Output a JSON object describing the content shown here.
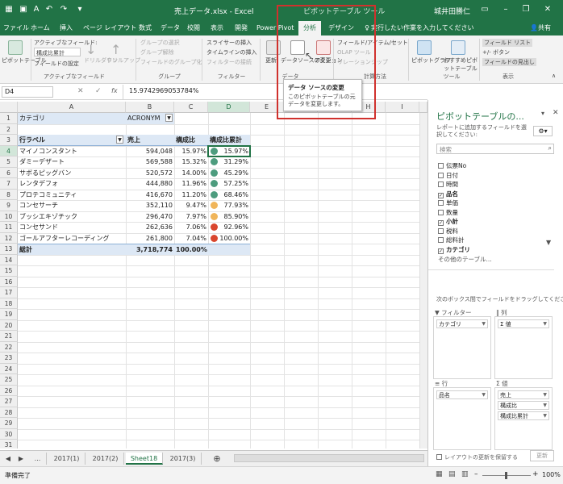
{
  "titlebar": {
    "title": "売上データ.xlsx - Excel",
    "context_tool": "ピボットテーブル ツール",
    "user": "城井田勝仁"
  },
  "tabs": [
    "ファイル",
    "ホーム",
    "挿入",
    "ページ レイアウト",
    "数式",
    "データ",
    "校閲",
    "表示",
    "開発",
    "Power Pivot",
    "分析",
    "デザイン"
  ],
  "tell_me": "実行したい作業を入力してください",
  "share": "共有",
  "ribbon": {
    "pivot_table": "ピボットテーブル",
    "active_field": "アクティブなフィールド:",
    "active_field_value": "構成比累計",
    "field_settings": "フィールドの設定",
    "drill_down": "ドリルダウン",
    "drill_up": "ドリルアップ",
    "group_selection": "グループの選択",
    "ungroup": "グループ解除",
    "group_field": "フィールドのグループ化",
    "insert_slicer": "スライサーの挿入",
    "insert_timeline": "タイムラインの挿入",
    "filter_connections": "フィルターの接続",
    "refresh": "更新",
    "change_source": "データソースの変更",
    "actions": "アクション",
    "fields_items_sets": "フィールド/アイテム/セット",
    "olap_tools": "OLAP ツール",
    "relationships": "リレーションシップ",
    "pivot_chart": "ピボットグラフ",
    "recommended": "おすすめピボットテーブル",
    "field_list": "フィールド リスト",
    "plus_minus": "+/- ボタン",
    "field_headers": "フィールドの見出し",
    "group_labels": [
      "アクティブなフィールド",
      "グループ",
      "フィルター",
      "データ",
      "計算方法",
      "ツール",
      "表示"
    ]
  },
  "tooltip": {
    "title": "データ ソースの変更",
    "body": "このピボットテーブルの元データを変更します。"
  },
  "formula_bar": {
    "name_box": "D4",
    "fx": "fx",
    "formula": "15.9742969053784%"
  },
  "columns": [
    "A",
    "B",
    "C",
    "D",
    "E",
    "F",
    "G",
    "H",
    "I"
  ],
  "rows_numbers": [
    "1",
    "2",
    "3",
    "4",
    "5",
    "6",
    "7",
    "8",
    "9",
    "10",
    "11",
    "12",
    "13",
    "14",
    "15",
    "16",
    "17",
    "18",
    "19",
    "20",
    "21",
    "22",
    "23",
    "24",
    "25",
    "26",
    "27",
    "28",
    "29",
    "30",
    "31",
    "32"
  ],
  "sheet": {
    "filter_label": "カテゴリ",
    "filter_value": "ACRONYM",
    "headers": [
      "行ラベル",
      "売上",
      "構成比",
      "構成比累計"
    ],
    "rows": [
      {
        "label": "マイノコンスタント",
        "sales": "594,048",
        "ratio": "15.97%",
        "cum": "15.97%",
        "dot": "#4d9c7e"
      },
      {
        "label": "ダミーデザート",
        "sales": "569,588",
        "ratio": "15.32%",
        "cum": "31.29%",
        "dot": "#4d9c7e"
      },
      {
        "label": "サボるピッグバン",
        "sales": "520,572",
        "ratio": "14.00%",
        "cum": "45.29%",
        "dot": "#4d9c7e"
      },
      {
        "label": "レンタデフォ",
        "sales": "444,880",
        "ratio": "11.96%",
        "cum": "57.25%",
        "dot": "#4d9c7e"
      },
      {
        "label": "プロテコミュニティ",
        "sales": "416,670",
        "ratio": "11.20%",
        "cum": "68.46%",
        "dot": "#4d9c7e"
      },
      {
        "label": "コンセサーチ",
        "sales": "352,110",
        "ratio": "9.47%",
        "cum": "77.93%",
        "dot": "#f0b55a"
      },
      {
        "label": "ブッシエキゾチック",
        "sales": "296,470",
        "ratio": "7.97%",
        "cum": "85.90%",
        "dot": "#f0b55a"
      },
      {
        "label": "コンセサンド",
        "sales": "262,636",
        "ratio": "7.06%",
        "cum": "92.96%",
        "dot": "#d9462e"
      },
      {
        "label": "ゴールアフターレコーディング",
        "sales": "261,800",
        "ratio": "7.04%",
        "cum": "100.00%",
        "dot": "#d9462e"
      }
    ],
    "total": {
      "label": "総計",
      "sales": "3,718,774",
      "ratio": "100.00%"
    }
  },
  "sheet_tabs": [
    "...",
    "2017(1)",
    "2017(2)",
    "Sheet18",
    "2017(3)"
  ],
  "status": "準備完了",
  "zoom": "100%",
  "pane": {
    "title": "ピボットテーブルの...",
    "subtitle": "レポートに追加するフィールドを選択してください:",
    "search": "検索",
    "fields": [
      {
        "name": "伝票No",
        "checked": false
      },
      {
        "name": "日付",
        "checked": false
      },
      {
        "name": "時間",
        "checked": false
      },
      {
        "name": "品名",
        "checked": true
      },
      {
        "name": "単価",
        "checked": false
      },
      {
        "name": "数量",
        "checked": false
      },
      {
        "name": "小計",
        "checked": true
      },
      {
        "name": "税料",
        "checked": false
      },
      {
        "name": "総料計",
        "checked": false
      },
      {
        "name": "カテゴリ",
        "checked": true
      }
    ],
    "other_tables": "その他のテーブル...",
    "drag_hint": "次のボックス間でフィールドをドラッグしてください:",
    "area_filter": "フィルター",
    "area_columns": "列",
    "area_rows": "行",
    "area_values": "値",
    "filter_chip": "カテゴリ",
    "columns_chip": "Σ 値",
    "rows_chip": "品名",
    "values_chips": [
      "売上",
      "構成比",
      "構成比累計"
    ],
    "defer": "レイアウトの更新を保留する",
    "update": "更新"
  }
}
